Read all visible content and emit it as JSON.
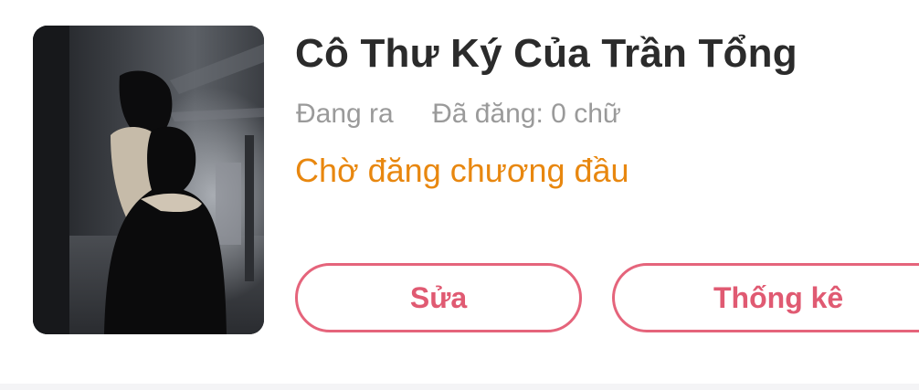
{
  "book": {
    "title": "Cô Thư Ký Của Trần Tổng",
    "state": "Đang ra",
    "words": "Đã đăng: 0 chữ",
    "status": "Chờ đăng chương đầu"
  },
  "actions": {
    "edit_label": "Sửa",
    "stats_label": "Thống kê"
  },
  "colors": {
    "accent": "#e5647b",
    "status": "#e8870f",
    "title": "#2b2b2b",
    "meta": "#9a9a9a"
  }
}
